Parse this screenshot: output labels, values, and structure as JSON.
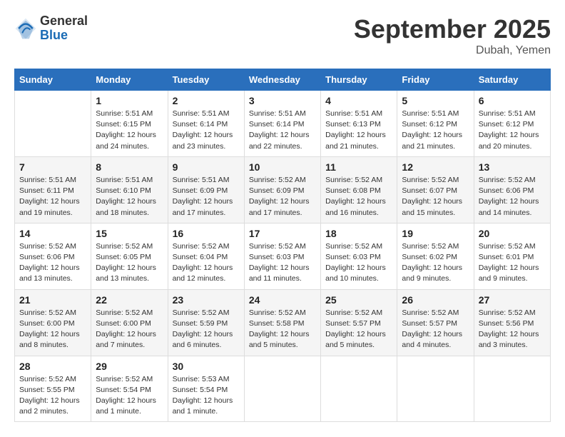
{
  "logo": {
    "general": "General",
    "blue": "Blue"
  },
  "title": "September 2025",
  "location": "Dubah, Yemen",
  "days_of_week": [
    "Sunday",
    "Monday",
    "Tuesday",
    "Wednesday",
    "Thursday",
    "Friday",
    "Saturday"
  ],
  "weeks": [
    [
      {
        "day": "",
        "info": ""
      },
      {
        "day": "1",
        "info": "Sunrise: 5:51 AM\nSunset: 6:15 PM\nDaylight: 12 hours\nand 24 minutes."
      },
      {
        "day": "2",
        "info": "Sunrise: 5:51 AM\nSunset: 6:14 PM\nDaylight: 12 hours\nand 23 minutes."
      },
      {
        "day": "3",
        "info": "Sunrise: 5:51 AM\nSunset: 6:14 PM\nDaylight: 12 hours\nand 22 minutes."
      },
      {
        "day": "4",
        "info": "Sunrise: 5:51 AM\nSunset: 6:13 PM\nDaylight: 12 hours\nand 21 minutes."
      },
      {
        "day": "5",
        "info": "Sunrise: 5:51 AM\nSunset: 6:12 PM\nDaylight: 12 hours\nand 21 minutes."
      },
      {
        "day": "6",
        "info": "Sunrise: 5:51 AM\nSunset: 6:12 PM\nDaylight: 12 hours\nand 20 minutes."
      }
    ],
    [
      {
        "day": "7",
        "info": "Sunrise: 5:51 AM\nSunset: 6:11 PM\nDaylight: 12 hours\nand 19 minutes."
      },
      {
        "day": "8",
        "info": "Sunrise: 5:51 AM\nSunset: 6:10 PM\nDaylight: 12 hours\nand 18 minutes."
      },
      {
        "day": "9",
        "info": "Sunrise: 5:51 AM\nSunset: 6:09 PM\nDaylight: 12 hours\nand 17 minutes."
      },
      {
        "day": "10",
        "info": "Sunrise: 5:52 AM\nSunset: 6:09 PM\nDaylight: 12 hours\nand 17 minutes."
      },
      {
        "day": "11",
        "info": "Sunrise: 5:52 AM\nSunset: 6:08 PM\nDaylight: 12 hours\nand 16 minutes."
      },
      {
        "day": "12",
        "info": "Sunrise: 5:52 AM\nSunset: 6:07 PM\nDaylight: 12 hours\nand 15 minutes."
      },
      {
        "day": "13",
        "info": "Sunrise: 5:52 AM\nSunset: 6:06 PM\nDaylight: 12 hours\nand 14 minutes."
      }
    ],
    [
      {
        "day": "14",
        "info": "Sunrise: 5:52 AM\nSunset: 6:06 PM\nDaylight: 12 hours\nand 13 minutes."
      },
      {
        "day": "15",
        "info": "Sunrise: 5:52 AM\nSunset: 6:05 PM\nDaylight: 12 hours\nand 13 minutes."
      },
      {
        "day": "16",
        "info": "Sunrise: 5:52 AM\nSunset: 6:04 PM\nDaylight: 12 hours\nand 12 minutes."
      },
      {
        "day": "17",
        "info": "Sunrise: 5:52 AM\nSunset: 6:03 PM\nDaylight: 12 hours\nand 11 minutes."
      },
      {
        "day": "18",
        "info": "Sunrise: 5:52 AM\nSunset: 6:03 PM\nDaylight: 12 hours\nand 10 minutes."
      },
      {
        "day": "19",
        "info": "Sunrise: 5:52 AM\nSunset: 6:02 PM\nDaylight: 12 hours\nand 9 minutes."
      },
      {
        "day": "20",
        "info": "Sunrise: 5:52 AM\nSunset: 6:01 PM\nDaylight: 12 hours\nand 9 minutes."
      }
    ],
    [
      {
        "day": "21",
        "info": "Sunrise: 5:52 AM\nSunset: 6:00 PM\nDaylight: 12 hours\nand 8 minutes."
      },
      {
        "day": "22",
        "info": "Sunrise: 5:52 AM\nSunset: 6:00 PM\nDaylight: 12 hours\nand 7 minutes."
      },
      {
        "day": "23",
        "info": "Sunrise: 5:52 AM\nSunset: 5:59 PM\nDaylight: 12 hours\nand 6 minutes."
      },
      {
        "day": "24",
        "info": "Sunrise: 5:52 AM\nSunset: 5:58 PM\nDaylight: 12 hours\nand 5 minutes."
      },
      {
        "day": "25",
        "info": "Sunrise: 5:52 AM\nSunset: 5:57 PM\nDaylight: 12 hours\nand 5 minutes."
      },
      {
        "day": "26",
        "info": "Sunrise: 5:52 AM\nSunset: 5:57 PM\nDaylight: 12 hours\nand 4 minutes."
      },
      {
        "day": "27",
        "info": "Sunrise: 5:52 AM\nSunset: 5:56 PM\nDaylight: 12 hours\nand 3 minutes."
      }
    ],
    [
      {
        "day": "28",
        "info": "Sunrise: 5:52 AM\nSunset: 5:55 PM\nDaylight: 12 hours\nand 2 minutes."
      },
      {
        "day": "29",
        "info": "Sunrise: 5:52 AM\nSunset: 5:54 PM\nDaylight: 12 hours\nand 1 minute."
      },
      {
        "day": "30",
        "info": "Sunrise: 5:53 AM\nSunset: 5:54 PM\nDaylight: 12 hours\nand 1 minute."
      },
      {
        "day": "",
        "info": ""
      },
      {
        "day": "",
        "info": ""
      },
      {
        "day": "",
        "info": ""
      },
      {
        "day": "",
        "info": ""
      }
    ]
  ]
}
